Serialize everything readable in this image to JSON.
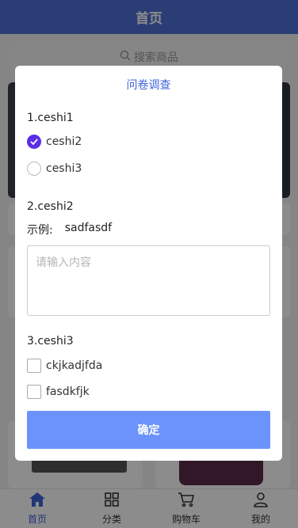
{
  "nav": {
    "title": "首页"
  },
  "search": {
    "placeholder": "搜索商品"
  },
  "tabbar": {
    "items": [
      {
        "label": "首页",
        "icon": "home-icon",
        "active": true
      },
      {
        "label": "分类",
        "icon": "grid-icon",
        "active": false
      },
      {
        "label": "购物车",
        "icon": "cart-icon",
        "active": false
      },
      {
        "label": "我的",
        "icon": "user-icon",
        "active": false
      }
    ]
  },
  "dialog": {
    "title": "问卷调查",
    "questions": [
      {
        "title": "1.ceshi1",
        "type": "radio",
        "options": [
          {
            "label": "ceshi2",
            "checked": true
          },
          {
            "label": "ceshi3",
            "checked": false
          }
        ]
      },
      {
        "title": "2.ceshi2",
        "type": "text",
        "example_label": "示例:",
        "example_value": "sadfasdf",
        "placeholder": "请输入内容"
      },
      {
        "title": "3.ceshi3",
        "type": "checkbox",
        "options": [
          {
            "label": "ckjkadjfda",
            "checked": false
          },
          {
            "label": "fasdkfjk",
            "checked": false
          }
        ]
      }
    ],
    "confirm_label": "确定"
  },
  "colors": {
    "accent": "#3d63d9",
    "radio_checked": "#5b2ee6",
    "confirm_button": "#6b93fb",
    "nav": "#4f6fd6"
  }
}
